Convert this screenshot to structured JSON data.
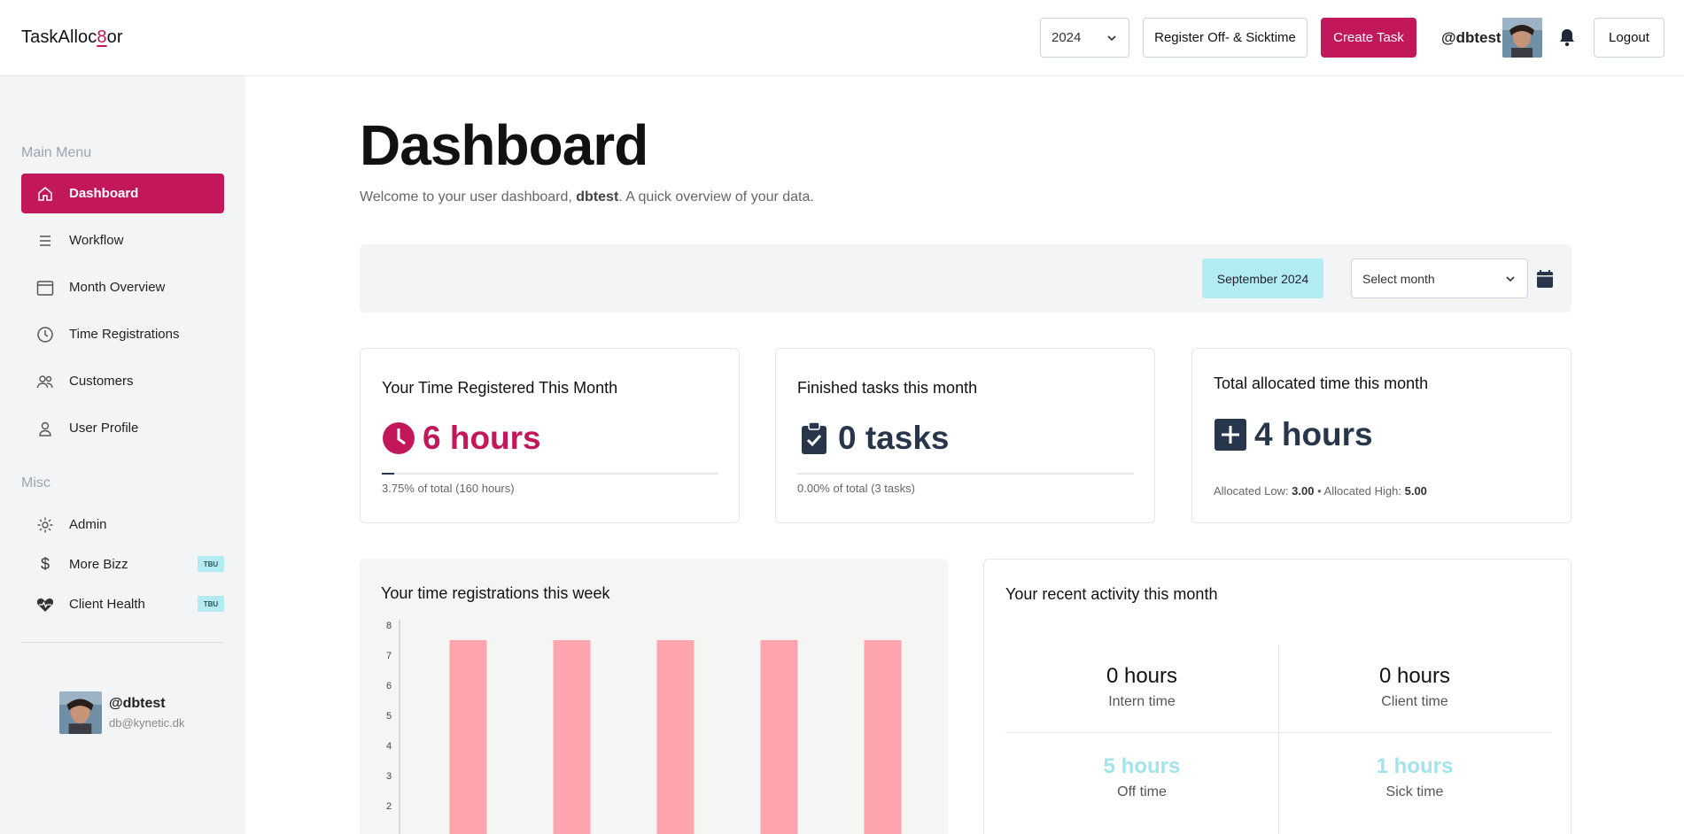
{
  "app": {
    "logo_prefix": "TaskAlloc",
    "logo_accent": "8",
    "logo_suffix": "or"
  },
  "header": {
    "year": "2024",
    "register_label": "Register Off- & Sicktime",
    "create_label": "Create Task",
    "username": "@dbtest",
    "logout_label": "Logout"
  },
  "sidebar": {
    "main_menu_label": "Main Menu",
    "items": [
      {
        "label": "Dashboard",
        "icon": "home-icon",
        "active": true
      },
      {
        "label": "Workflow",
        "icon": "list-icon"
      },
      {
        "label": "Month Overview",
        "icon": "calendar-icon"
      },
      {
        "label": "Time Registrations",
        "icon": "clock-icon"
      },
      {
        "label": "Customers",
        "icon": "users-icon"
      },
      {
        "label": "User Profile",
        "icon": "user-icon"
      }
    ],
    "misc_label": "Misc",
    "misc_items": [
      {
        "label": "Admin",
        "icon": "gear-icon"
      },
      {
        "label": "More Bizz",
        "icon": "dollar-icon",
        "badge": "TBU"
      },
      {
        "label": "Client Health",
        "icon": "heart-pulse-icon",
        "badge": "TBU"
      }
    ],
    "profile": {
      "handle": "@dbtest",
      "email": "db@kynetic.dk"
    }
  },
  "main": {
    "title": "Dashboard",
    "subtitle_pre": "Welcome to your user dashboard, ",
    "subtitle_user": "dbtest",
    "subtitle_post": ". A quick overview of your data.",
    "current_month": "September 2024",
    "month_select_placeholder": "Select month",
    "cards": {
      "time": {
        "title": "Your Time Registered This Month",
        "value": "6 hours",
        "footer": "3.75% of total (160 hours)",
        "progress": 0.0375
      },
      "tasks": {
        "title": "Finished tasks this month",
        "value": "0 tasks",
        "footer": "0.00% of total (3 tasks)",
        "progress": 0
      },
      "allocated": {
        "title": "Total allocated time this month",
        "value": "4 hours",
        "low_label": "Allocated Low: ",
        "low": "3.00",
        "sep": " • ",
        "high_label": "Allocated High: ",
        "high": "5.00"
      }
    },
    "week_panel_title": "Your time registrations this week",
    "activity": {
      "title": "Your recent activity this month",
      "cells": [
        {
          "value": "0 hours",
          "label": "Intern time"
        },
        {
          "value": "0 hours",
          "label": "Client time"
        },
        {
          "value": "5 hours",
          "label": "Off time"
        },
        {
          "value": "1 hours",
          "label": "Sick time"
        }
      ]
    }
  },
  "colors": {
    "accent": "#c2185b",
    "bar": "#fda4af",
    "chip": "#b2ebf2",
    "navy": "#27364a"
  },
  "chart_data": {
    "type": "bar",
    "categories": [
      "",
      "",
      "",
      "",
      ""
    ],
    "values": [
      7.5,
      7.5,
      7.5,
      7.5,
      7.5
    ],
    "ylim": [
      1,
      8
    ],
    "yticks": [
      "8",
      "7",
      "6",
      "5",
      "4",
      "3",
      "2"
    ],
    "title": "",
    "xlabel": "",
    "ylabel": ""
  }
}
